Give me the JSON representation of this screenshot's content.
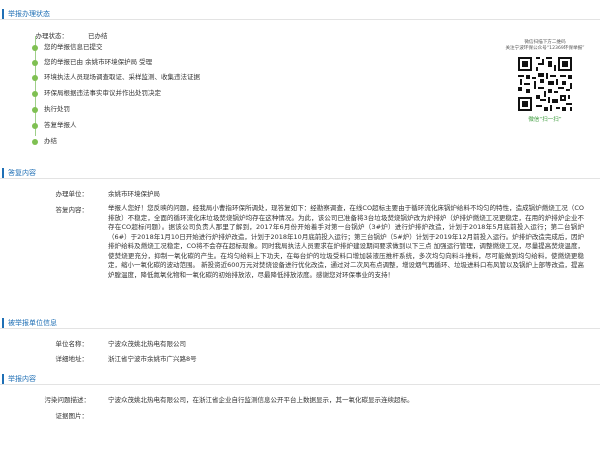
{
  "sections": {
    "status_title": "举报办理状态",
    "reply_title": "答复内容",
    "reported_unit_title": "被举报单位信息",
    "report_content_title": "举报内容"
  },
  "status": {
    "label": "办理状态：",
    "value": "已办结",
    "steps": [
      "您的举报信息已提交",
      "您的举报已由 余姚市环境保护局 受理",
      "环境执法人员现场调查取证、采样监测、收集违法证据",
      "环保局根据违法事实审议并作出处罚决定",
      "执行处罚",
      "答复举报人",
      "办结"
    ]
  },
  "qr": {
    "caption_line1": "微信扫描下方二维码",
    "caption_line2": "关注宁波环保公众号“12369环保举报”",
    "caption_green": "微信“扫一扫”"
  },
  "reply": {
    "unit_label": "办理单位：",
    "unit_value": "余姚市环境保护局",
    "content_label": "答复内容：",
    "content_value": "举报人您好！您反映的问题，经我局小曹指环保所调处，现答复如下：经勘察调查，在线CO超标主要由于循环流化床锅炉给料不均匀的特性，造成锅炉燃烧工况（CO排放）不稳定，全面的循环流化床垃圾焚烧锅炉均存在这种情况。为此，该公司已准备将3台垃圾焚烧锅炉改为炉排炉（炉排炉燃烧工况更稳定，在用的炉排炉企业不存在CO超标问题）。据该公司负责人那里了解到，2017年6月份开始着手对第一台锅炉（3#炉）进行炉排炉改造，计划于2018年5月底前投入运行；第二台锅炉（6#）于2018年1月10日开始进行炉排炉改造，计划于2018年10月底前投入运行；第三台锅炉（5#炉）计划于2019年12月前投入运行。炉排炉改造完成后，因炉排炉给料及燃烧工况稳定，CO将不会存在超标现象。同时我局执法人员要求在炉排炉建设期间要求做到以下三点 加强运行管理，调整燃烧工况，尽量提高焚烧温度，使焚烧更充分，抑制一氧化碳的产生。在均匀给料上下功夫，在每台炉的垃圾受料口增加装液压推杆系统，多次均匀向料斗推料，尽可能做到均匀给料，使燃烧更稳定，缩小一氧化碳的波动范围。 新投资近600万元对焚烧设备进行优化改造，通过对二次风布点调整，增设烟气再循环、垃圾进料口布风管以及锅炉上部等改造，提高炉膛温度，降低氮氧化物和一氧化碳的初始排放浓，尽最降低排放浓度。感谢您对环保事业的支持！"
  },
  "reported_unit": {
    "name_label": "单位名称：",
    "name_value": "宁波众茂姚北热电有限公司",
    "address_label": "详细地址：",
    "address_value": "浙江省宁波市余姚市广兴路8号"
  },
  "report": {
    "problem_label": "污染问题描述：",
    "problem_value": "宁波众茂姚北热电有限公司，在浙江省企业自行监测信息公开平台上数据显示，其一氧化碳显示连续超标。",
    "evidence_label": "证据图片："
  },
  "colors": {
    "accent_blue": "#1f6fb5",
    "timeline_green": "#7fc052",
    "qr_green": "#3a9b3a"
  }
}
